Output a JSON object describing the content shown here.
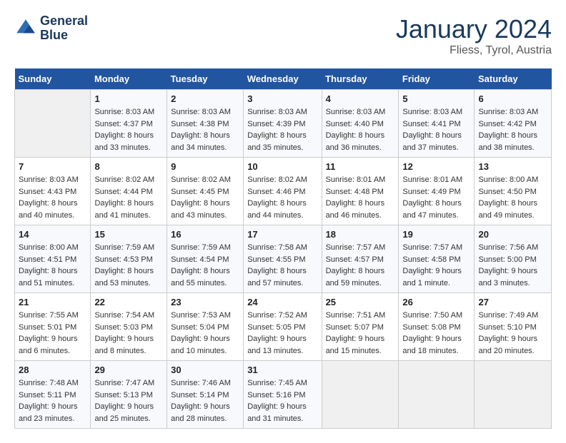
{
  "header": {
    "logo_line1": "General",
    "logo_line2": "Blue",
    "month": "January 2024",
    "location": "Fliess, Tyrol, Austria"
  },
  "weekdays": [
    "Sunday",
    "Monday",
    "Tuesday",
    "Wednesday",
    "Thursday",
    "Friday",
    "Saturday"
  ],
  "weeks": [
    [
      {
        "day": "",
        "sunrise": "",
        "sunset": "",
        "daylight": ""
      },
      {
        "day": "1",
        "sunrise": "Sunrise: 8:03 AM",
        "sunset": "Sunset: 4:37 PM",
        "daylight": "Daylight: 8 hours and 33 minutes."
      },
      {
        "day": "2",
        "sunrise": "Sunrise: 8:03 AM",
        "sunset": "Sunset: 4:38 PM",
        "daylight": "Daylight: 8 hours and 34 minutes."
      },
      {
        "day": "3",
        "sunrise": "Sunrise: 8:03 AM",
        "sunset": "Sunset: 4:39 PM",
        "daylight": "Daylight: 8 hours and 35 minutes."
      },
      {
        "day": "4",
        "sunrise": "Sunrise: 8:03 AM",
        "sunset": "Sunset: 4:40 PM",
        "daylight": "Daylight: 8 hours and 36 minutes."
      },
      {
        "day": "5",
        "sunrise": "Sunrise: 8:03 AM",
        "sunset": "Sunset: 4:41 PM",
        "daylight": "Daylight: 8 hours and 37 minutes."
      },
      {
        "day": "6",
        "sunrise": "Sunrise: 8:03 AM",
        "sunset": "Sunset: 4:42 PM",
        "daylight": "Daylight: 8 hours and 38 minutes."
      }
    ],
    [
      {
        "day": "7",
        "sunrise": "Sunrise: 8:03 AM",
        "sunset": "Sunset: 4:43 PM",
        "daylight": "Daylight: 8 hours and 40 minutes."
      },
      {
        "day": "8",
        "sunrise": "Sunrise: 8:02 AM",
        "sunset": "Sunset: 4:44 PM",
        "daylight": "Daylight: 8 hours and 41 minutes."
      },
      {
        "day": "9",
        "sunrise": "Sunrise: 8:02 AM",
        "sunset": "Sunset: 4:45 PM",
        "daylight": "Daylight: 8 hours and 43 minutes."
      },
      {
        "day": "10",
        "sunrise": "Sunrise: 8:02 AM",
        "sunset": "Sunset: 4:46 PM",
        "daylight": "Daylight: 8 hours and 44 minutes."
      },
      {
        "day": "11",
        "sunrise": "Sunrise: 8:01 AM",
        "sunset": "Sunset: 4:48 PM",
        "daylight": "Daylight: 8 hours and 46 minutes."
      },
      {
        "day": "12",
        "sunrise": "Sunrise: 8:01 AM",
        "sunset": "Sunset: 4:49 PM",
        "daylight": "Daylight: 8 hours and 47 minutes."
      },
      {
        "day": "13",
        "sunrise": "Sunrise: 8:00 AM",
        "sunset": "Sunset: 4:50 PM",
        "daylight": "Daylight: 8 hours and 49 minutes."
      }
    ],
    [
      {
        "day": "14",
        "sunrise": "Sunrise: 8:00 AM",
        "sunset": "Sunset: 4:51 PM",
        "daylight": "Daylight: 8 hours and 51 minutes."
      },
      {
        "day": "15",
        "sunrise": "Sunrise: 7:59 AM",
        "sunset": "Sunset: 4:53 PM",
        "daylight": "Daylight: 8 hours and 53 minutes."
      },
      {
        "day": "16",
        "sunrise": "Sunrise: 7:59 AM",
        "sunset": "Sunset: 4:54 PM",
        "daylight": "Daylight: 8 hours and 55 minutes."
      },
      {
        "day": "17",
        "sunrise": "Sunrise: 7:58 AM",
        "sunset": "Sunset: 4:55 PM",
        "daylight": "Daylight: 8 hours and 57 minutes."
      },
      {
        "day": "18",
        "sunrise": "Sunrise: 7:57 AM",
        "sunset": "Sunset: 4:57 PM",
        "daylight": "Daylight: 8 hours and 59 minutes."
      },
      {
        "day": "19",
        "sunrise": "Sunrise: 7:57 AM",
        "sunset": "Sunset: 4:58 PM",
        "daylight": "Daylight: 9 hours and 1 minute."
      },
      {
        "day": "20",
        "sunrise": "Sunrise: 7:56 AM",
        "sunset": "Sunset: 5:00 PM",
        "daylight": "Daylight: 9 hours and 3 minutes."
      }
    ],
    [
      {
        "day": "21",
        "sunrise": "Sunrise: 7:55 AM",
        "sunset": "Sunset: 5:01 PM",
        "daylight": "Daylight: 9 hours and 6 minutes."
      },
      {
        "day": "22",
        "sunrise": "Sunrise: 7:54 AM",
        "sunset": "Sunset: 5:03 PM",
        "daylight": "Daylight: 9 hours and 8 minutes."
      },
      {
        "day": "23",
        "sunrise": "Sunrise: 7:53 AM",
        "sunset": "Sunset: 5:04 PM",
        "daylight": "Daylight: 9 hours and 10 minutes."
      },
      {
        "day": "24",
        "sunrise": "Sunrise: 7:52 AM",
        "sunset": "Sunset: 5:05 PM",
        "daylight": "Daylight: 9 hours and 13 minutes."
      },
      {
        "day": "25",
        "sunrise": "Sunrise: 7:51 AM",
        "sunset": "Sunset: 5:07 PM",
        "daylight": "Daylight: 9 hours and 15 minutes."
      },
      {
        "day": "26",
        "sunrise": "Sunrise: 7:50 AM",
        "sunset": "Sunset: 5:08 PM",
        "daylight": "Daylight: 9 hours and 18 minutes."
      },
      {
        "day": "27",
        "sunrise": "Sunrise: 7:49 AM",
        "sunset": "Sunset: 5:10 PM",
        "daylight": "Daylight: 9 hours and 20 minutes."
      }
    ],
    [
      {
        "day": "28",
        "sunrise": "Sunrise: 7:48 AM",
        "sunset": "Sunset: 5:11 PM",
        "daylight": "Daylight: 9 hours and 23 minutes."
      },
      {
        "day": "29",
        "sunrise": "Sunrise: 7:47 AM",
        "sunset": "Sunset: 5:13 PM",
        "daylight": "Daylight: 9 hours and 25 minutes."
      },
      {
        "day": "30",
        "sunrise": "Sunrise: 7:46 AM",
        "sunset": "Sunset: 5:14 PM",
        "daylight": "Daylight: 9 hours and 28 minutes."
      },
      {
        "day": "31",
        "sunrise": "Sunrise: 7:45 AM",
        "sunset": "Sunset: 5:16 PM",
        "daylight": "Daylight: 9 hours and 31 minutes."
      },
      {
        "day": "",
        "sunrise": "",
        "sunset": "",
        "daylight": ""
      },
      {
        "day": "",
        "sunrise": "",
        "sunset": "",
        "daylight": ""
      },
      {
        "day": "",
        "sunrise": "",
        "sunset": "",
        "daylight": ""
      }
    ]
  ]
}
